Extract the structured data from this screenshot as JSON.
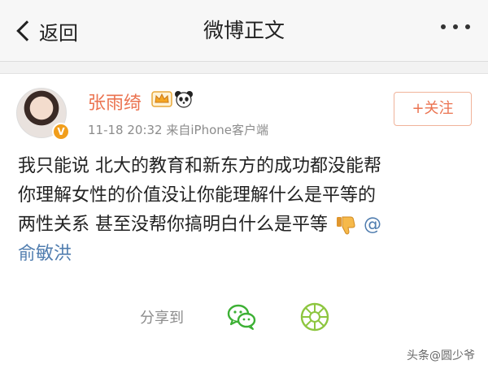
{
  "nav": {
    "back_label": "返回",
    "title": "微博正文"
  },
  "post": {
    "username": "张雨绮",
    "timestamp": "11-18 20:32",
    "source": "来自iPhone客户端",
    "follow_label": "+关注",
    "lines": [
      "我只能说 北大的教育和新东方的成功都没能帮",
      "你理解女性的价值没让你能理解什么是平等的",
      "两性关系 甚至没帮你搞明白什么是平等"
    ],
    "mention_at": "@",
    "mention_name": "俞敏洪"
  },
  "share": {
    "label": "分享到"
  },
  "watermark": "头条@圆少爷",
  "colors": {
    "username": "#eb7350",
    "link": "#507daf",
    "verified": "#f19e1c"
  },
  "icons": [
    "back-chevron-icon",
    "more-dots-icon",
    "verified-badge-icon",
    "crown-icon",
    "panda-icon",
    "thumbs-down-icon",
    "wechat-icon",
    "moments-icon"
  ]
}
